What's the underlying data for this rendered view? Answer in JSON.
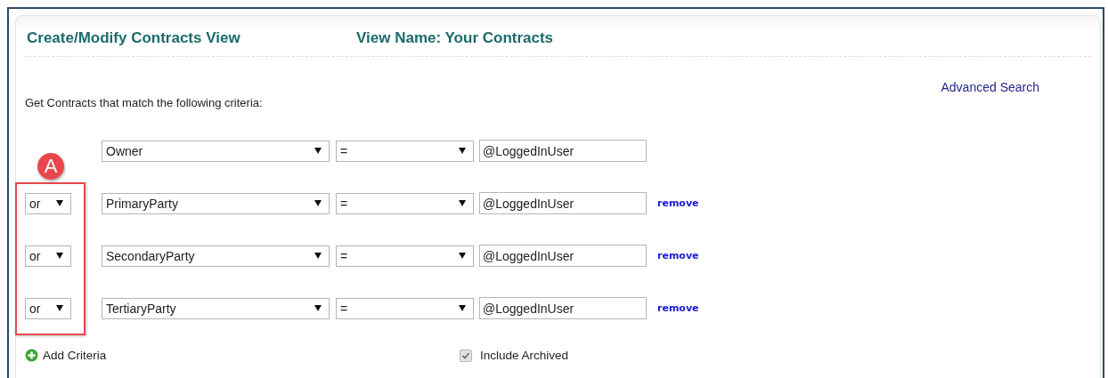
{
  "header": {
    "title": "Create/Modify Contracts View",
    "view_name": "View Name: Your Contracts"
  },
  "advanced_search": "Advanced Search",
  "intro": "Get Contracts that match the following criteria:",
  "criteria": [
    {
      "field": "Owner",
      "operator": "=",
      "value": "@LoggedInUser"
    },
    {
      "connector": "or",
      "field": "PrimaryParty",
      "operator": "=",
      "value": "@LoggedInUser",
      "remove": "remove"
    },
    {
      "connector": "or",
      "field": "SecondaryParty",
      "operator": "=",
      "value": "@LoggedInUser",
      "remove": "remove"
    },
    {
      "connector": "or",
      "field": "TertiaryParty",
      "operator": "=",
      "value": "@LoggedInUser",
      "remove": "remove"
    }
  ],
  "add_criteria": "Add Criteria",
  "include_archived": {
    "label": "Include Archived",
    "checked": true,
    "disabled": true
  },
  "annotation": {
    "label": "A"
  }
}
